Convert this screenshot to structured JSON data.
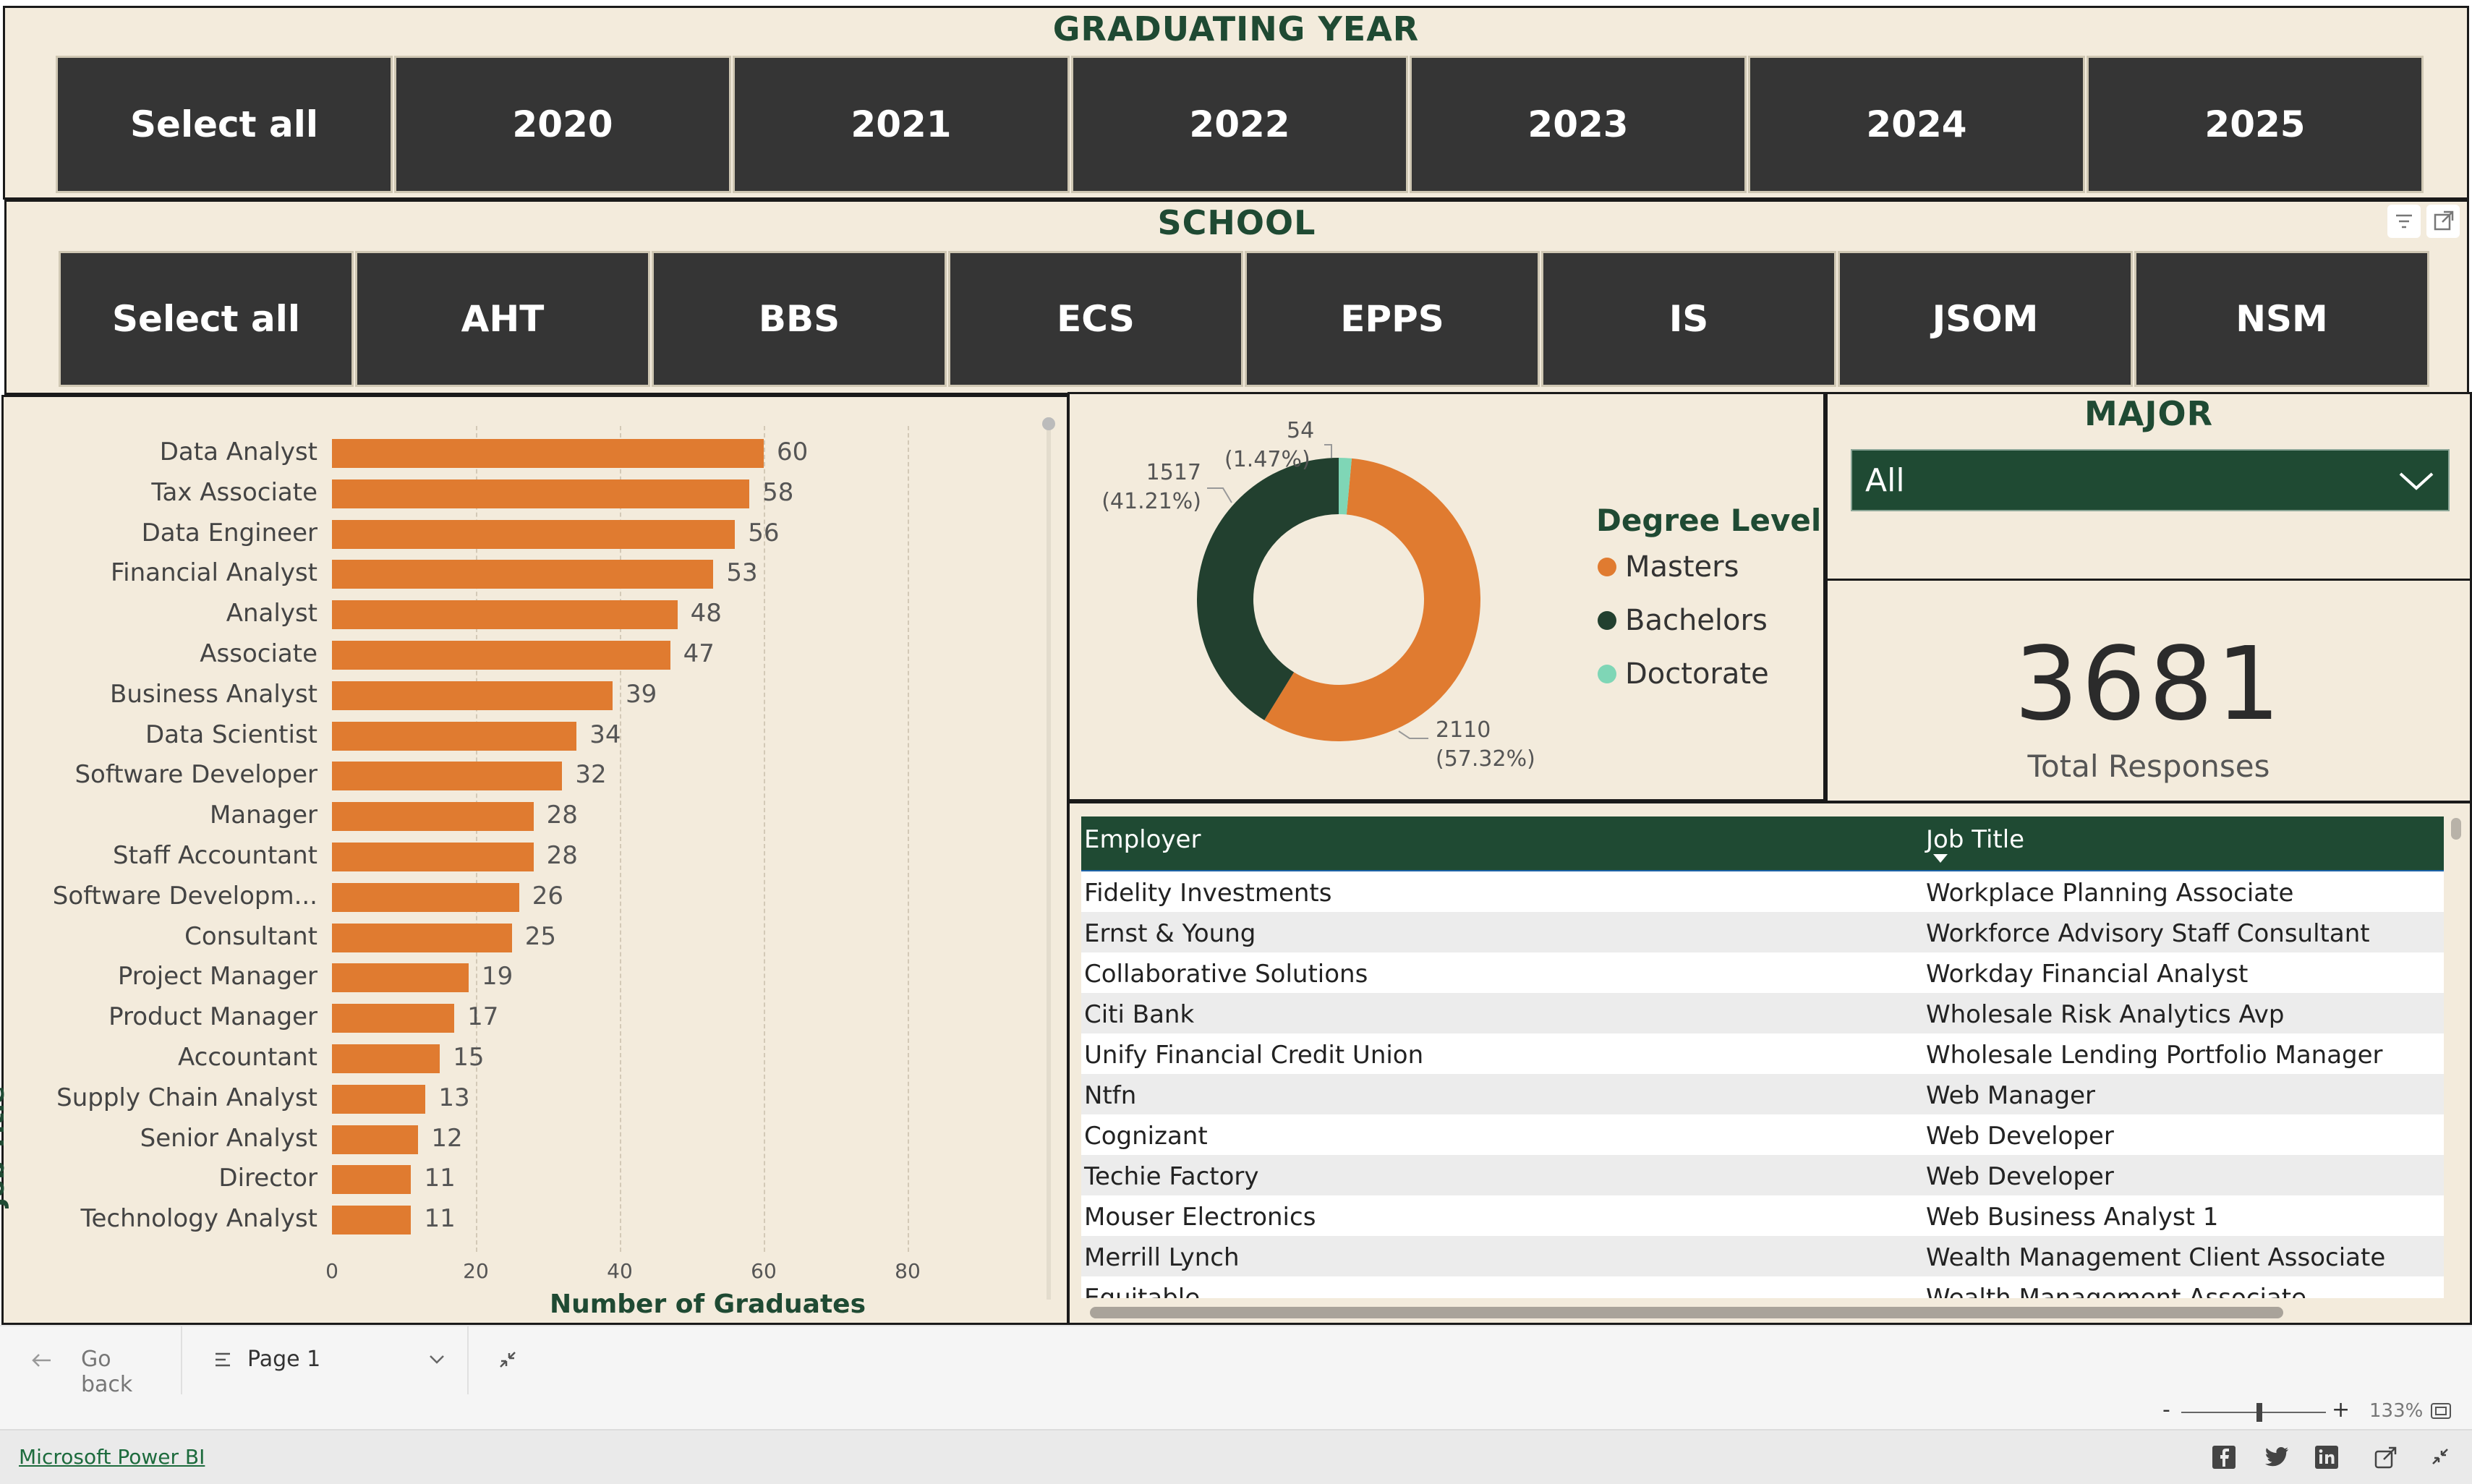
{
  "graduating_year": {
    "title": "GRADUATING YEAR",
    "buttons": [
      "Select all",
      "2020",
      "2021",
      "2022",
      "2023",
      "2024",
      "2025"
    ]
  },
  "school": {
    "title": "SCHOOL",
    "buttons": [
      "Select all",
      "AHT",
      "BBS",
      "ECS",
      "EPPS",
      "IS",
      "JSOM",
      "NSM"
    ]
  },
  "bar_chart": {
    "ylabel": "Job Title",
    "xlabel": "Number of Graduates"
  },
  "donut": {
    "legend_title": "Degree Level",
    "callouts": [
      {
        "value": "2110",
        "pct": "(57.32%)"
      },
      {
        "value": "1517",
        "pct": "(41.21%)"
      },
      {
        "value": "54",
        "pct": "(1.47%)"
      }
    ]
  },
  "major": {
    "title": "MAJOR",
    "selected": "All"
  },
  "kpi": {
    "value": "3681",
    "label": "Total Responses"
  },
  "table": {
    "headers": [
      "Employer",
      "Job Title"
    ],
    "rows": [
      [
        "Fidelity Investments",
        "Workplace Planning Associate"
      ],
      [
        "Ernst & Young",
        "Workforce Advisory Staff Consultant"
      ],
      [
        "Collaborative Solutions",
        "Workday Financial Analyst"
      ],
      [
        "Citi Bank",
        "Wholesale Risk Analytics Avp"
      ],
      [
        "Unify Financial Credit Union",
        "Wholesale Lending Portfolio Manager"
      ],
      [
        "Ntfn",
        "Web Manager"
      ],
      [
        "Cognizant",
        "Web Developer"
      ],
      [
        "Techie Factory",
        "Web Developer"
      ],
      [
        "Mouser Electronics",
        "Web Business Analyst 1"
      ],
      [
        "Merrill Lynch",
        "Wealth Management Client Associate"
      ],
      [
        "Equitable",
        "Wealth Management Associate"
      ]
    ]
  },
  "footer": {
    "go_back": "Go back",
    "page": "Page 1",
    "zoom_minus": "-",
    "zoom_plus": "+",
    "zoom": "133%",
    "brand_link": "Microsoft Power BI"
  },
  "colors": {
    "accent_orange": "#e07b30",
    "dark_green": "#1f4a33",
    "teal": "#7fd6b6",
    "panel_bg": "#f3ebdc",
    "button_bg": "#353535"
  },
  "chart_data": [
    {
      "type": "bar",
      "orientation": "horizontal",
      "categories": [
        "Data Analyst",
        "Tax Associate",
        "Data Engineer",
        "Financial Analyst",
        "Analyst",
        "Associate",
        "Business Analyst",
        "Data Scientist",
        "Software Developer",
        "Manager",
        "Staff Accountant",
        "Software Developm...",
        "Consultant",
        "Project Manager",
        "Product Manager",
        "Accountant",
        "Supply Chain Analyst",
        "Senior Analyst",
        "Director",
        "Technology Analyst"
      ],
      "values": [
        60,
        58,
        56,
        53,
        48,
        47,
        39,
        34,
        32,
        28,
        28,
        26,
        25,
        19,
        17,
        15,
        13,
        12,
        11,
        11
      ],
      "xlabel": "Number of Graduates",
      "ylabel": "Job Title",
      "xlim": [
        0,
        80
      ],
      "xticks": [
        0,
        20,
        40,
        60,
        80
      ],
      "grid": true
    },
    {
      "type": "pie",
      "style": "donut",
      "legend_title": "Degree Level",
      "labels": [
        "Masters",
        "Bachelors",
        "Doctorate"
      ],
      "values": [
        2110,
        1517,
        54
      ],
      "colors": [
        "#e07b30",
        "#22402f",
        "#7fd6b6"
      ],
      "legend_position": "right"
    }
  ]
}
